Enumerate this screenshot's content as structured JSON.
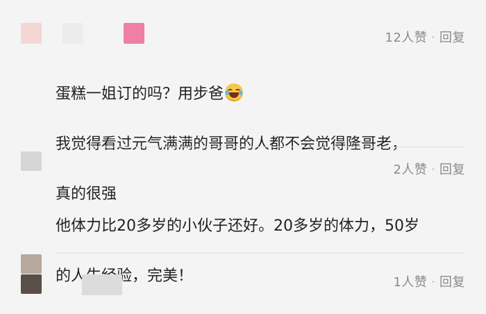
{
  "colors": {
    "background": "#f4f4f4",
    "text": "#222222",
    "meta": "#8a8a8a"
  },
  "comments": [
    {
      "likes_label": "12人赞",
      "reply_label": "回复",
      "lines": [
        "蛋糕一姐订的吗？用步爸",
        "我觉得看过元气满满的哥哥的人都不会觉得隆哥老，",
        "真的很强"
      ],
      "emoji": "laughing-crying-emoji"
    },
    {
      "likes_label": "2人赞",
      "reply_label": "回复",
      "lines": [
        "他体力比20多岁的小伙子还好。20多岁的体力，50岁",
        "的人生经验，完美！"
      ]
    },
    {
      "likes_label": "1人赞",
      "reply_label": "回复"
    }
  ]
}
